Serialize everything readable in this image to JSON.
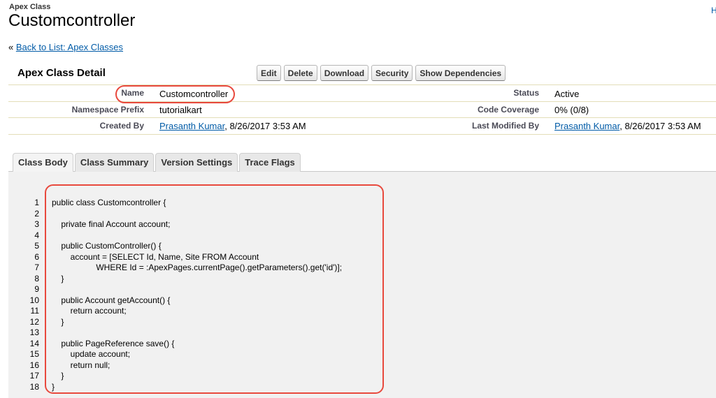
{
  "header": {
    "kicker": "Apex Class",
    "title": "Customcontroller",
    "help_fragment": "H"
  },
  "back_link": {
    "prefix": "« ",
    "label": "Back to List: Apex Classes"
  },
  "detail": {
    "section_title": "Apex Class Detail",
    "buttons": [
      "Edit",
      "Delete",
      "Download",
      "Security",
      "Show Dependencies"
    ],
    "fields": {
      "name_label": "Name",
      "name_value": "Customcontroller",
      "status_label": "Status",
      "status_value": "Active",
      "namespace_label": "Namespace Prefix",
      "namespace_value": "tutorialkart",
      "coverage_label": "Code Coverage",
      "coverage_value": "0% (0/8)",
      "created_label": "Created By",
      "created_user": "Prasanth Kumar",
      "created_date": ", 8/26/2017 3:53 AM",
      "modified_label": "Last Modified By",
      "modified_user": "Prasanth Kumar",
      "modified_date": ", 8/26/2017 3:53 AM"
    }
  },
  "tabs": [
    "Class Body",
    "Class Summary",
    "Version Settings",
    "Trace Flags"
  ],
  "code": {
    "line_numbers": [
      "1",
      "2",
      "3",
      "4",
      "5",
      "6",
      "7",
      "8",
      "9",
      "10",
      "11",
      "12",
      "13",
      "14",
      "15",
      "16",
      "17",
      "18"
    ],
    "lines": [
      "public class Customcontroller {",
      "",
      "    private final Account account;",
      "",
      "    public CustomController() {",
      "        account = [SELECT Id, Name, Site FROM Account",
      "                   WHERE Id = :ApexPages.currentPage().getParameters().get('id')];",
      "    }",
      "",
      "    public Account getAccount() {",
      "        return account;",
      "    }",
      "",
      "    public PageReference save() {",
      "        update account;",
      "        return null;",
      "    }",
      "}"
    ]
  },
  "colors": {
    "link": "#015ba7",
    "highlight": "#e8493d",
    "panel": "#f1f1f1"
  }
}
